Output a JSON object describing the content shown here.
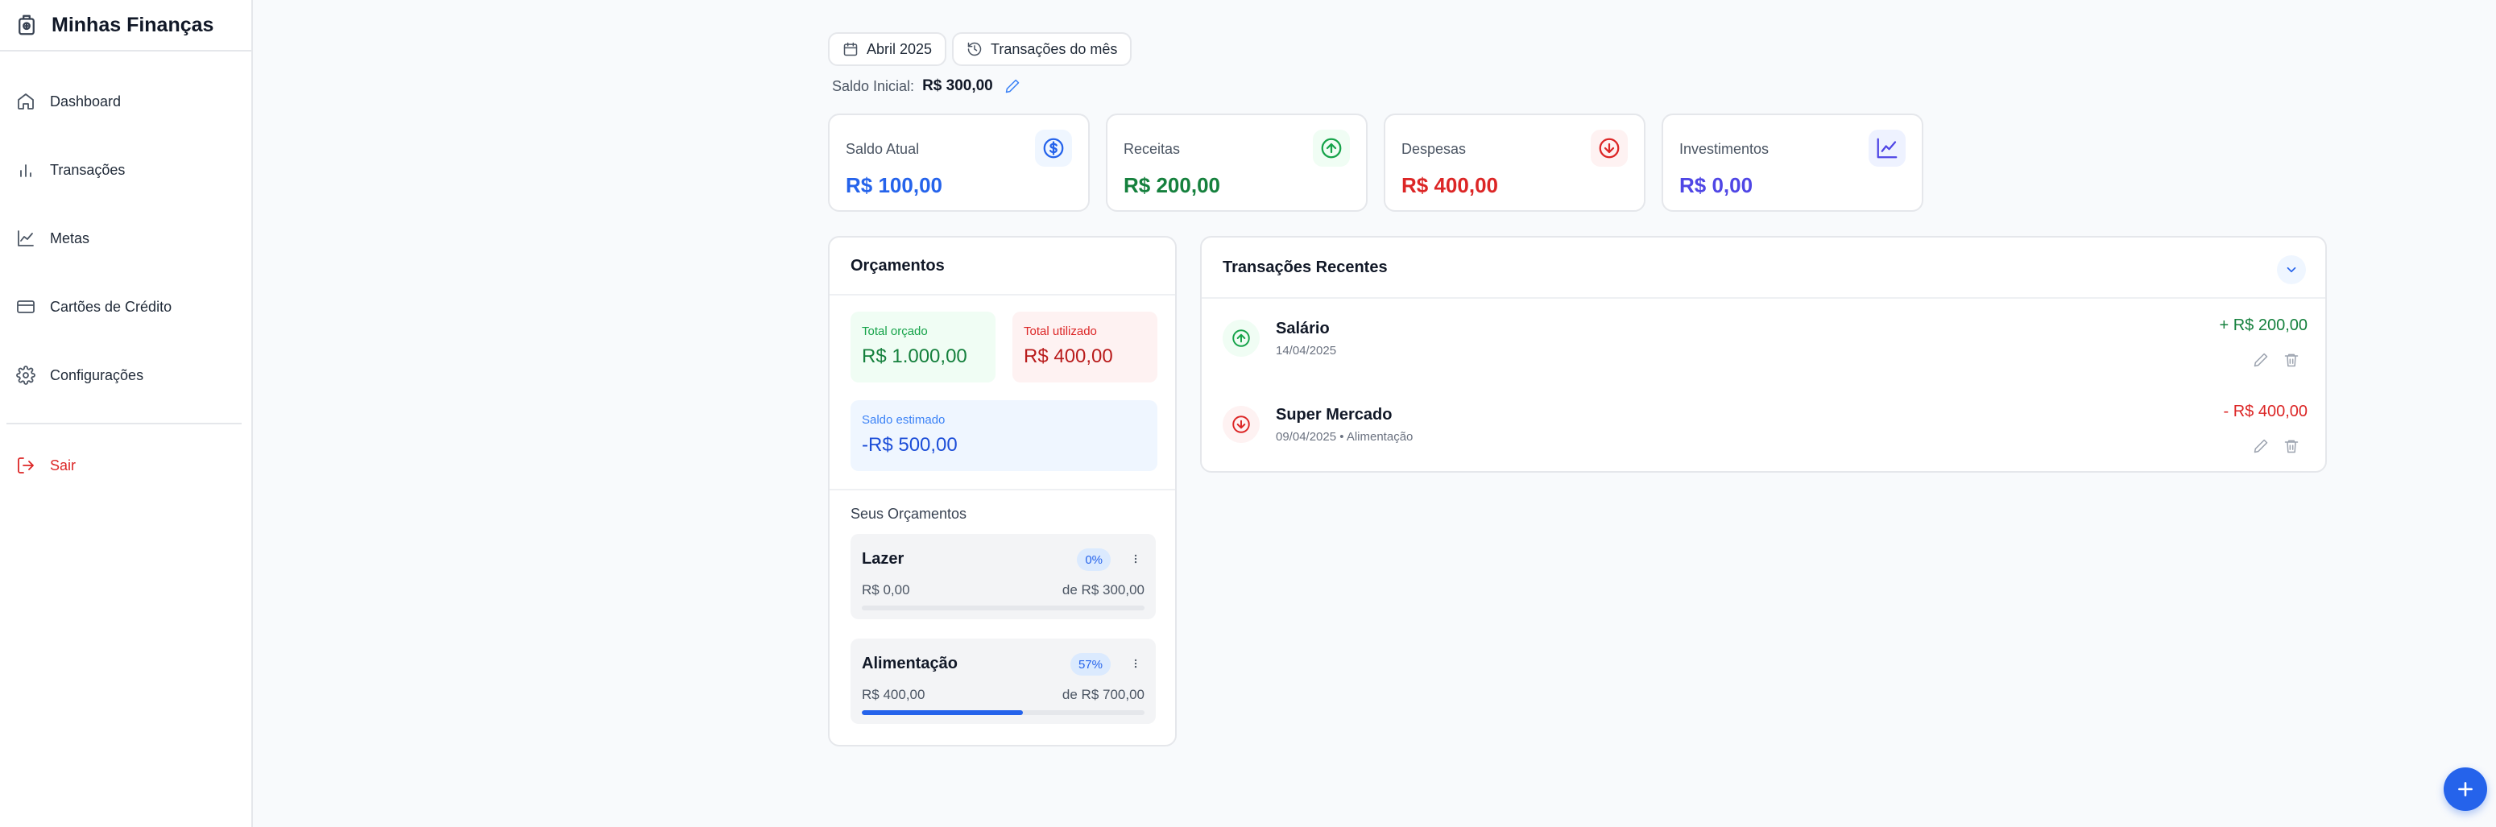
{
  "app": {
    "title": "Minhas Finanças"
  },
  "sidebar": {
    "items": [
      {
        "label": "Dashboard",
        "icon": "home-icon"
      },
      {
        "label": "Transações",
        "icon": "bar-chart-icon"
      },
      {
        "label": "Metas",
        "icon": "line-chart-icon"
      },
      {
        "label": "Cartões de Crédito",
        "icon": "credit-card-icon"
      },
      {
        "label": "Configurações",
        "icon": "gear-icon"
      }
    ],
    "logout": "Sair"
  },
  "header": {
    "month": "Abril 2025",
    "history_label": "Transações do mês",
    "saldo_inicial_label": "Saldo Inicial:",
    "saldo_inicial_value": "R$ 300,00"
  },
  "stats": [
    {
      "label": "Saldo Atual",
      "value": "R$ 100,00",
      "color": "#2563eb",
      "icon": "dollar-circle-icon"
    },
    {
      "label": "Receitas",
      "value": "R$ 200,00",
      "color": "#16a34a",
      "icon": "arrow-up-circle-icon"
    },
    {
      "label": "Despesas",
      "value": "R$ 400,00",
      "color": "#dc2626",
      "icon": "arrow-down-circle-icon"
    },
    {
      "label": "Investimentos",
      "value": "R$ 0,00",
      "color": "#4f46e5",
      "icon": "trending-chart-icon"
    }
  ],
  "budgets": {
    "title": "Orçamentos",
    "total_orcado_label": "Total orçado",
    "total_orcado_value": "R$ 1.000,00",
    "total_utilizado_label": "Total utilizado",
    "total_utilizado_value": "R$ 400,00",
    "saldo_estimado_label": "Saldo estimado",
    "saldo_estimado_value": "-R$ 500,00",
    "list_title": "Seus Orçamentos",
    "items": [
      {
        "name": "Lazer",
        "percent": "0%",
        "used": "R$ 0,00",
        "limit": "de R$ 300,00",
        "progress": 0
      },
      {
        "name": "Alimentação",
        "percent": "57%",
        "used": "R$ 400,00",
        "limit": "de R$ 700,00",
        "progress": 0.57
      }
    ]
  },
  "transactions": {
    "title": "Transações Recentes",
    "items": [
      {
        "title": "Salário",
        "detail": "14/04/2025",
        "amount": "+ R$ 200,00",
        "type": "income"
      },
      {
        "title": "Super Mercado",
        "detail": "09/04/2025 • Alimentação",
        "amount": "- R$ 400,00",
        "type": "expense"
      }
    ]
  }
}
